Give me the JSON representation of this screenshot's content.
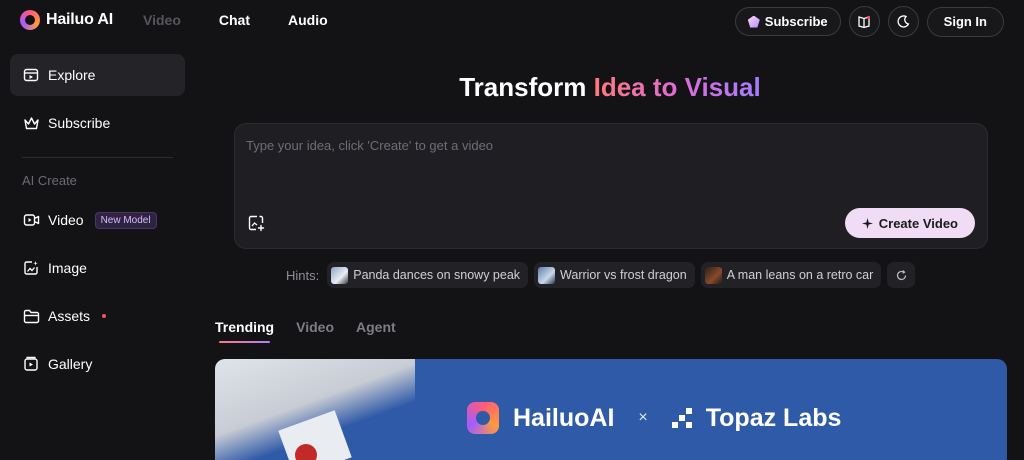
{
  "header": {
    "logo_text": "Hailuo AI",
    "nav": [
      "Video",
      "Chat",
      "Audio"
    ],
    "subscribe_label": "Subscribe",
    "signin_label": "Sign In"
  },
  "sidebar": {
    "explore": "Explore",
    "subscribe": "Subscribe",
    "section_label": "AI Create",
    "video": "Video",
    "video_badge": "New Model",
    "image": "Image",
    "assets": "Assets",
    "gallery": "Gallery"
  },
  "main": {
    "title_part1": "Transform ",
    "title_part2": "Idea to Visual",
    "prompt_placeholder": "Type your idea, click 'Create' to get a video",
    "create_label": "Create Video",
    "hints_label": "Hints:",
    "hints": [
      "Panda dances on snowy peak",
      "Warrior vs frost dragon",
      "A man leans on a retro car"
    ],
    "tabs": [
      "Trending",
      "Video",
      "Agent"
    ],
    "banner": {
      "logo_left": "HailuoAI",
      "separator": "×",
      "logo_right": "Topaz Labs"
    }
  },
  "colors": {
    "background": "#131316",
    "accent_pink": "#ff7a7a",
    "accent_purple": "#a37dff",
    "create_button": "#f1dcf5",
    "banner_blue": "#2f5aa7"
  }
}
